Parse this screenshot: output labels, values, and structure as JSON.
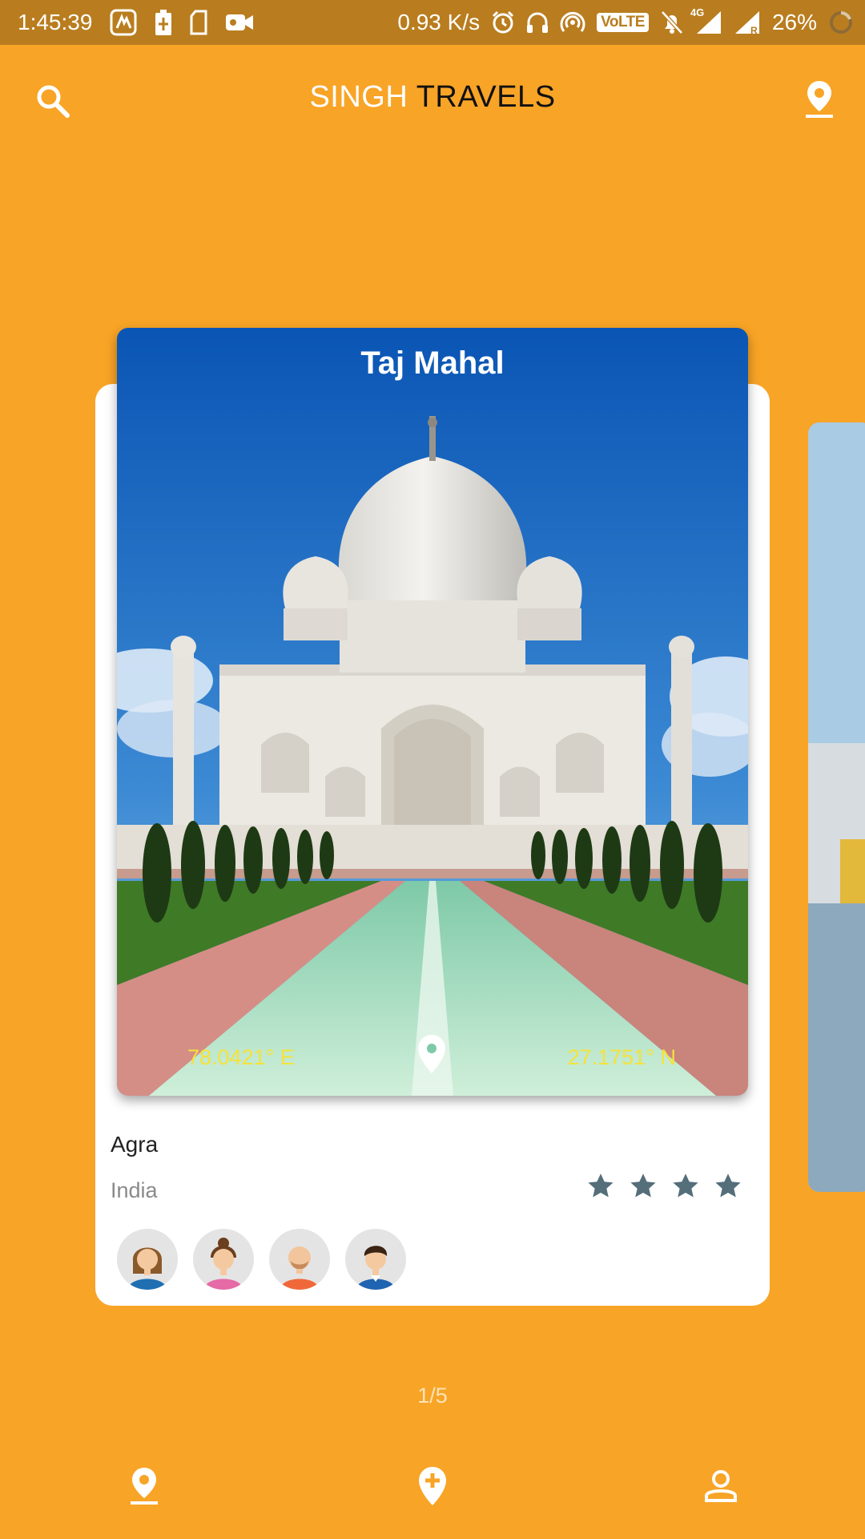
{
  "status_bar": {
    "time": "1:45:39",
    "net_speed": "0.93 K/s",
    "volte": "VoLTE",
    "network": "4G",
    "battery": "26%"
  },
  "header": {
    "title_part1": "SINGH",
    "title_part2": "TRAVELS",
    "left_icon": "search-icon",
    "right_icon": "location-pin-icon"
  },
  "place": {
    "name": "Taj Mahal",
    "longitude": "78.0421° E",
    "latitude": "27.1751° N",
    "city": "Agra",
    "country": "India",
    "rating": 4,
    "visitors": [
      "woman-avatar",
      "girl-avatar",
      "bearded-man-avatar",
      "man-avatar"
    ]
  },
  "pager": {
    "text": "1/5"
  },
  "bottom_nav": {
    "items": [
      "location-pin-icon",
      "add-location-icon",
      "person-icon"
    ]
  },
  "colors": {
    "background": "#F8A426",
    "status_bar": "#B97D1F",
    "star": "#546E7A",
    "coordinate_text": "#F6E23A"
  }
}
